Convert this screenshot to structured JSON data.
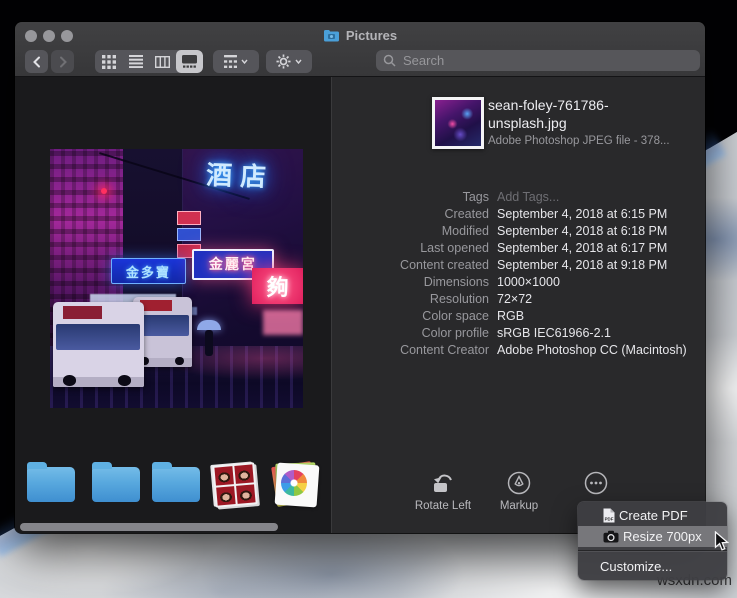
{
  "window": {
    "title": "Pictures",
    "toolbar": {
      "search_placeholder": "Search"
    }
  },
  "file": {
    "name": "sean-foley-761786-unsplash.jpg",
    "kind": "Adobe Photoshop JPEG file - 378..."
  },
  "tags": {
    "label": "Tags",
    "placeholder": "Add Tags..."
  },
  "metadata": [
    {
      "label": "Created",
      "value": "September 4, 2018 at 6:15 PM"
    },
    {
      "label": "Modified",
      "value": "September 4, 2018 at 6:18 PM"
    },
    {
      "label": "Last opened",
      "value": "September 4, 2018 at 6:17 PM"
    },
    {
      "label": "Content created",
      "value": "September 4, 2018 at 9:18 PM"
    },
    {
      "label": "Dimensions",
      "value": "1000×1000"
    },
    {
      "label": "Resolution",
      "value": "72×72"
    },
    {
      "label": "Color space",
      "value": "RGB"
    },
    {
      "label": "Color profile",
      "value": "sRGB IEC61966-2.1"
    },
    {
      "label": "Content Creator",
      "value": "Adobe Photoshop CC (Macintosh)"
    }
  ],
  "actions": {
    "rotate_left": "Rotate Left",
    "markup": "Markup"
  },
  "quick_menu": {
    "create_pdf": "Create PDF",
    "resize": "Resize 700px",
    "customize": "Customize..."
  },
  "photo": {
    "signs": {
      "hotel": "酒店",
      "gold": "金多寶",
      "palace": "金麗宮",
      "enough": "夠"
    }
  },
  "watermark": "wsxdn.com",
  "colors": {
    "folder_blue": "#4a9fd8",
    "menu_highlight": "#77777b",
    "neon_pink": "#ff3b7a",
    "neon_blue": "#3fa9ff"
  }
}
